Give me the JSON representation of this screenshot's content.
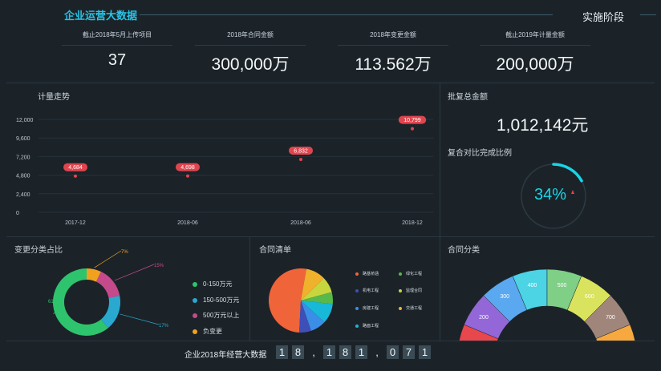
{
  "header": {
    "title": "企业运营大数据",
    "stage": "实施阶段"
  },
  "kpis": [
    {
      "label": "截止2018年5月上传项目",
      "value": "37"
    },
    {
      "label": "2018年合同金额",
      "value": "300,000万"
    },
    {
      "label": "2018年变更金额",
      "value": "113.562万"
    },
    {
      "label": "截止2019年计量金额",
      "value": "200,000万"
    }
  ],
  "trend": {
    "title": "计量走势"
  },
  "approval": {
    "title": "批复总金额",
    "value": "1,012,142元"
  },
  "completion": {
    "title": "复合对比完成比例",
    "value": "34%",
    "percent": 34,
    "accent": "#17d6e6"
  },
  "change_pie": {
    "title": "变更分类占比",
    "legend": [
      {
        "label": "0-150万元",
        "color": "#2ec46d"
      },
      {
        "label": "150-500万元",
        "color": "#29a9cf"
      },
      {
        "label": "500万元以上",
        "color": "#c54a8b"
      },
      {
        "label": "负变更",
        "color": "#f0a21f"
      }
    ]
  },
  "contract_list": {
    "title": "合同清单",
    "legend": [
      {
        "label": "路基桥涵",
        "color": "#f0643a"
      },
      {
        "label": "绿化工程",
        "color": "#58b84a"
      },
      {
        "label": "机电工程",
        "color": "#3e4fb8"
      },
      {
        "label": "监理合同",
        "color": "#c7d63f"
      },
      {
        "label": "房建工程",
        "color": "#3b8ee6"
      },
      {
        "label": "交通工程",
        "color": "#f0b12c"
      },
      {
        "label": "路面工程",
        "color": "#18b8d8"
      }
    ]
  },
  "contract_category": {
    "title": "合同分类"
  },
  "footer": {
    "label": "企业2018年经营大数据",
    "digits": [
      "1",
      "8",
      ",",
      "1",
      "8",
      "1",
      ",",
      "0",
      "7",
      "1"
    ]
  },
  "chart_data": [
    {
      "type": "scatter",
      "title": "计量走势",
      "categories": [
        "2017-12",
        "2018-06",
        "2018-06",
        "2018-12"
      ],
      "values": [
        4684,
        4698,
        6832,
        10799
      ],
      "data_labels": [
        "4,684",
        "4,698",
        "6,832",
        "10,799"
      ],
      "y_ticks": [
        "0",
        "2,400",
        "4,800",
        "7,200",
        "9,600",
        "12,000"
      ],
      "ylim": [
        0,
        12000
      ],
      "grid": true,
      "color": "#e0454e"
    },
    {
      "type": "pie",
      "title": "变更分类占比",
      "labels": [
        "0-150万元",
        "150-500万元",
        "500万元以上",
        "负变更"
      ],
      "values": [
        61,
        17,
        15,
        7
      ],
      "data_labels": [
        "61%",
        "17%",
        "15%",
        "7%"
      ],
      "colors": [
        "#2ec46d",
        "#29a9cf",
        "#c54a8b",
        "#f0a21f"
      ],
      "donut": true
    },
    {
      "type": "pie",
      "title": "合同清单",
      "labels": [
        "路基桥涵",
        "交通工程",
        "监理合同",
        "绿化工程",
        "路面工程",
        "房建工程",
        "机电工程"
      ],
      "values": [
        52,
        10,
        8,
        6,
        10,
        8,
        6
      ],
      "colors": [
        "#f0643a",
        "#f0b12c",
        "#c7d63f",
        "#58b84a",
        "#18b8d8",
        "#3b8ee6",
        "#3e4fb8"
      ]
    },
    {
      "type": "pie",
      "title": "合同分类",
      "labels": [
        "100",
        "200",
        "300",
        "400",
        "500",
        "600",
        "700",
        "800"
      ],
      "values": [
        100,
        200,
        300,
        400,
        500,
        600,
        700,
        800
      ],
      "colors": [
        "#e8474d",
        "#9367d8",
        "#5aa8f0",
        "#4cd3e4",
        "#7fcf86",
        "#d9e35d",
        "#a0867a",
        "#f7a940"
      ],
      "half_donut": true
    }
  ]
}
